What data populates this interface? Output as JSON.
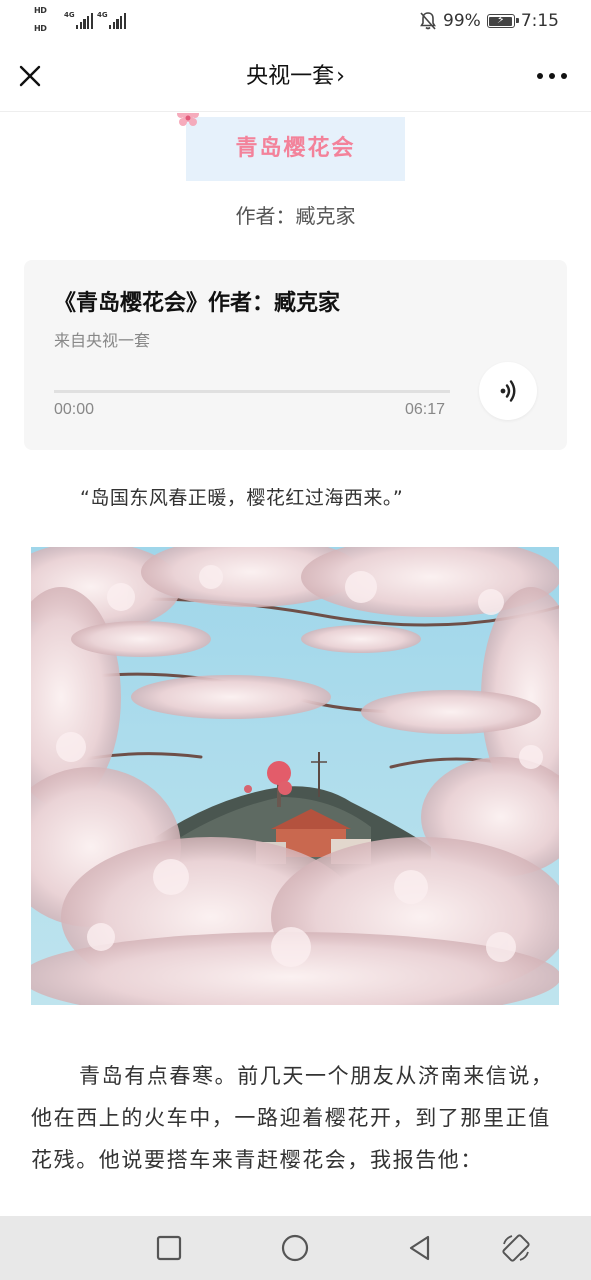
{
  "status_bar": {
    "hd_top": "HD",
    "hd_bottom": "HD",
    "signal_1_label": "4G",
    "signal_2_label": "4G",
    "battery_percent": "99%",
    "time": "7:15",
    "icons": [
      "mute-bell-icon",
      "battery-charging-icon"
    ]
  },
  "nav": {
    "title": "央视一套",
    "chevron": "›",
    "icons": [
      "close-icon",
      "more-dots-icon"
    ]
  },
  "article": {
    "banner_title": "青岛樱花会",
    "author_line": "作者：臧克家",
    "audio": {
      "title": "《青岛樱花会》作者：臧克家",
      "source": "来自央视一套",
      "current_time": "00:00",
      "total_time": "06:17",
      "progress": 0,
      "icon": "audio-play-icon"
    },
    "quote": "“岛国东风春正暖，樱花红过海西来。”",
    "paragraphs": [
      "青岛有点春寒。前几天一个朋友从济南来信说，他在西上的火车中，一路迎着樱花开，到了那里正值花残。他说要搭车来青赶樱花会，我报告他："
    ]
  },
  "system_nav": {
    "icons": [
      "recent-apps-icon",
      "home-icon",
      "back-icon",
      "rotate-screen-icon"
    ]
  },
  "colors": {
    "banner_bg": "#e6f1fb",
    "banner_text": "#f3829a",
    "card_bg": "#f6f6f6",
    "system_nav_bg": "#e8e8e8"
  }
}
